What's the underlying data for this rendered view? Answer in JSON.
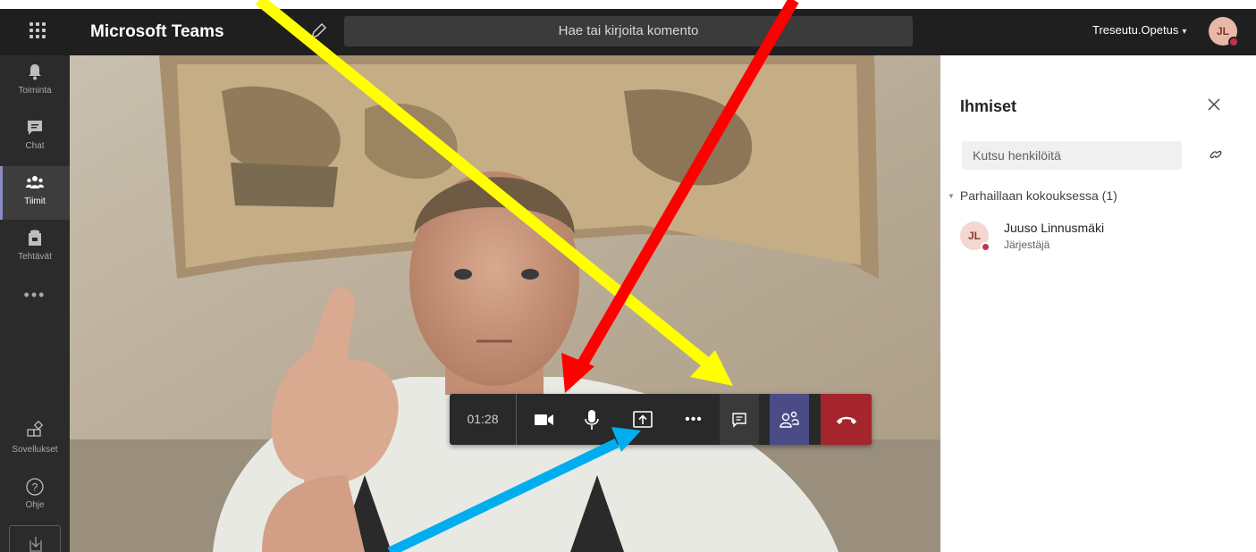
{
  "titlebar": {
    "app_title": "Microsoft Teams",
    "search_placeholder": "Hae tai kirjoita komento",
    "org_name": "Treseutu.Opetus",
    "user_initials": "JL"
  },
  "rail": {
    "items": [
      {
        "label": "Toiminta",
        "icon": "bell-icon"
      },
      {
        "label": "Chat",
        "icon": "chat-icon"
      },
      {
        "label": "Tiimit",
        "icon": "teams-icon"
      },
      {
        "label": "Tehtävät",
        "icon": "assignments-icon"
      },
      {
        "label": "Sovellukset",
        "icon": "apps-icon"
      },
      {
        "label": "Ohje",
        "icon": "help-icon"
      }
    ],
    "more_label": "•••"
  },
  "call": {
    "timer": "01:28",
    "more_label": "•••"
  },
  "people": {
    "title": "Ihmiset",
    "invite_placeholder": "Kutsu henkilöitä",
    "section_header": "Parhaillaan kokouksessa (1)",
    "participants": [
      {
        "initials": "JL",
        "name": "Juuso Linnusmäki",
        "role": "Järjestäjä"
      }
    ]
  },
  "colors": {
    "titlebar": "#1f1f1f",
    "rail": "#2b2b2b",
    "accent": "#4b4c87",
    "hangup": "#a4262c",
    "arrow_yellow": "#ffff00",
    "arrow_red": "#ff0000",
    "arrow_blue": "#00aeef"
  }
}
